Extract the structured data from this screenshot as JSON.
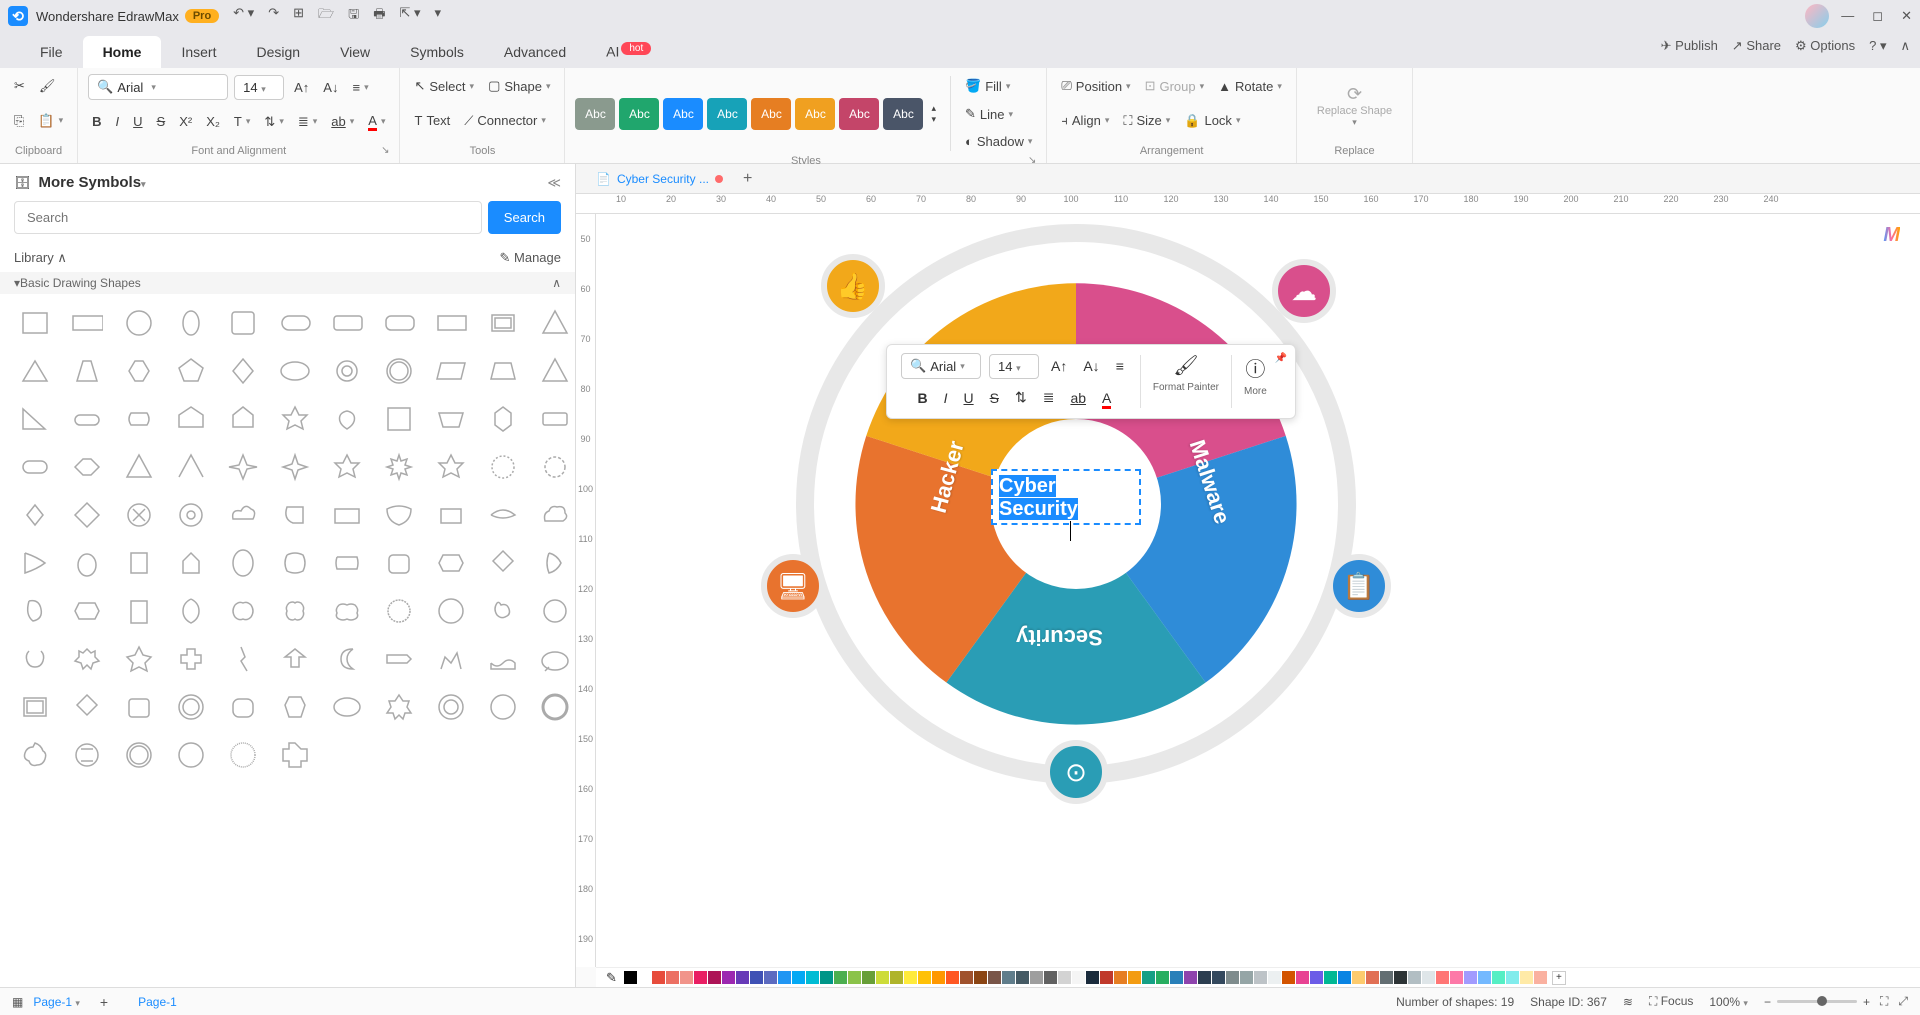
{
  "app": {
    "name": "Wondershare EdrawMax",
    "pro_badge": "Pro"
  },
  "menu": {
    "tabs": [
      "File",
      "Home",
      "Insert",
      "Design",
      "View",
      "Symbols",
      "Advanced",
      "AI"
    ],
    "active": 1,
    "hot_badge": "hot",
    "right": {
      "publish": "Publish",
      "share": "Share",
      "options": "Options"
    }
  },
  "ribbon": {
    "clipboard_label": "Clipboard",
    "font": {
      "name": "Arial",
      "size": "14",
      "group_label": "Font and Alignment"
    },
    "tools": {
      "select": "Select",
      "shape": "Shape",
      "text": "Text",
      "connector": "Connector",
      "group_label": "Tools"
    },
    "styles": {
      "label": "Styles",
      "swatch_label": "Abc",
      "colors": [
        "#8a9a8e",
        "#20a66d",
        "#1a8cff",
        "#17a2b8",
        "#e67e22",
        "#f0a020",
        "#c44569",
        "#4a5568"
      ],
      "fill": "Fill",
      "line": "Line",
      "shadow": "Shadow"
    },
    "arrangement": {
      "label": "Arrangement",
      "position": "Position",
      "group": "Group",
      "rotate": "Rotate",
      "align": "Align",
      "size": "Size",
      "lock": "Lock"
    },
    "replace": {
      "label": "Replace",
      "button": "Replace Shape"
    }
  },
  "left_panel": {
    "title": "More Symbols",
    "search_placeholder": "Search",
    "search_btn": "Search",
    "library": "Library",
    "manage": "Manage",
    "section": "Basic Drawing Shapes"
  },
  "doc": {
    "tab_title": "Cyber Security ...",
    "ruler_h": [
      "10",
      "20",
      "30",
      "40",
      "50",
      "60",
      "70",
      "80",
      "90",
      "100",
      "110",
      "120",
      "130",
      "140",
      "150",
      "160",
      "170",
      "180",
      "190",
      "200",
      "210",
      "220",
      "230",
      "240"
    ],
    "ruler_v": [
      "50",
      "60",
      "70",
      "80",
      "90",
      "100",
      "110",
      "120",
      "130",
      "140",
      "150",
      "160",
      "170",
      "180",
      "190"
    ]
  },
  "float": {
    "font": "Arial",
    "size": "14",
    "format_painter": "Format Painter",
    "more": "More"
  },
  "diagram": {
    "center_text": "Cyber Security",
    "segments": {
      "hacker": "Hacker",
      "security": "Security",
      "malware": "Malware"
    }
  },
  "colorbar": [
    "#000000",
    "#ffffff",
    "#e74c3c",
    "#ec7063",
    "#f1948a",
    "#e91e63",
    "#ad1457",
    "#9c27b0",
    "#673ab7",
    "#3f51b5",
    "#5c6bc0",
    "#2196f3",
    "#03a9f4",
    "#00bcd4",
    "#009688",
    "#4caf50",
    "#8bc34a",
    "#689f38",
    "#cddc39",
    "#afb42b",
    "#ffeb3b",
    "#ffc107",
    "#ff9800",
    "#ff5722",
    "#a0522d",
    "#8b4513",
    "#795548",
    "#607d8b",
    "#455a64",
    "#9e9e9e",
    "#616161",
    "#d3d3d3",
    "#f5f5f5",
    "#1a2b3c",
    "#c0392b",
    "#e67e22",
    "#f39c12",
    "#16a085",
    "#27ae60",
    "#2980b9",
    "#8e44ad",
    "#2c3e50",
    "#34495e",
    "#7f8c8d",
    "#95a5a6",
    "#bdc3c7",
    "#ecf0f1",
    "#d35400",
    "#e84393",
    "#6c5ce7",
    "#00b894",
    "#0984e3",
    "#fdcb6e",
    "#e17055",
    "#636e72",
    "#2d3436",
    "#b2bec3",
    "#dfe6e9",
    "#ff7675",
    "#fd79a8",
    "#a29bfe",
    "#74b9ff",
    "#55efc4",
    "#81ecec",
    "#ffeaa7",
    "#fab1a0"
  ],
  "status": {
    "page_label": "Page-1",
    "page_link": "Page-1",
    "shapes_count": "Number of shapes: 19",
    "shape_id": "Shape ID: 367",
    "focus": "Focus",
    "zoom": "100%"
  }
}
